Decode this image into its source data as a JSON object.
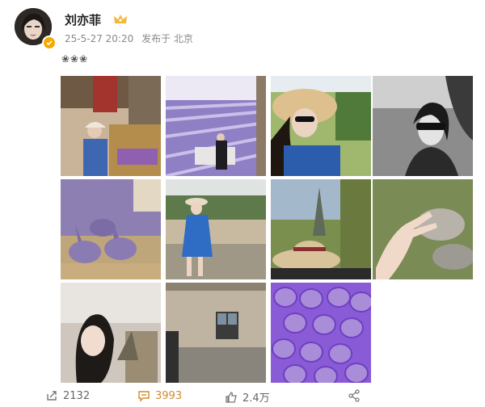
{
  "user": {
    "name": "刘亦菲",
    "badge_icon": "crown-icon"
  },
  "meta": {
    "timestamp": "25-5-27 20:20",
    "location": "发布于 北京"
  },
  "post_text": "❀❀❀",
  "photos": [
    {
      "icon": "market-photo"
    },
    {
      "icon": "lavender-field-photo"
    },
    {
      "icon": "sunhat-selfie-photo"
    },
    {
      "icon": "bw-portrait-photo"
    },
    {
      "icon": "lavender-bunnies-photo"
    },
    {
      "icon": "blue-dress-photo"
    },
    {
      "icon": "hat-tree-photo"
    },
    {
      "icon": "hand-on-rock-photo"
    },
    {
      "icon": "selfie-window-photo"
    },
    {
      "icon": "stone-house-photo"
    },
    {
      "icon": "lavender-sachets-photo"
    }
  ],
  "actions": {
    "share_count": "2132",
    "comment_count": "3993",
    "like_count": "2.4万"
  },
  "colors": {
    "accent": "#f4a900",
    "comment": "#d08b2c",
    "lavender": "#8a5bd6"
  }
}
